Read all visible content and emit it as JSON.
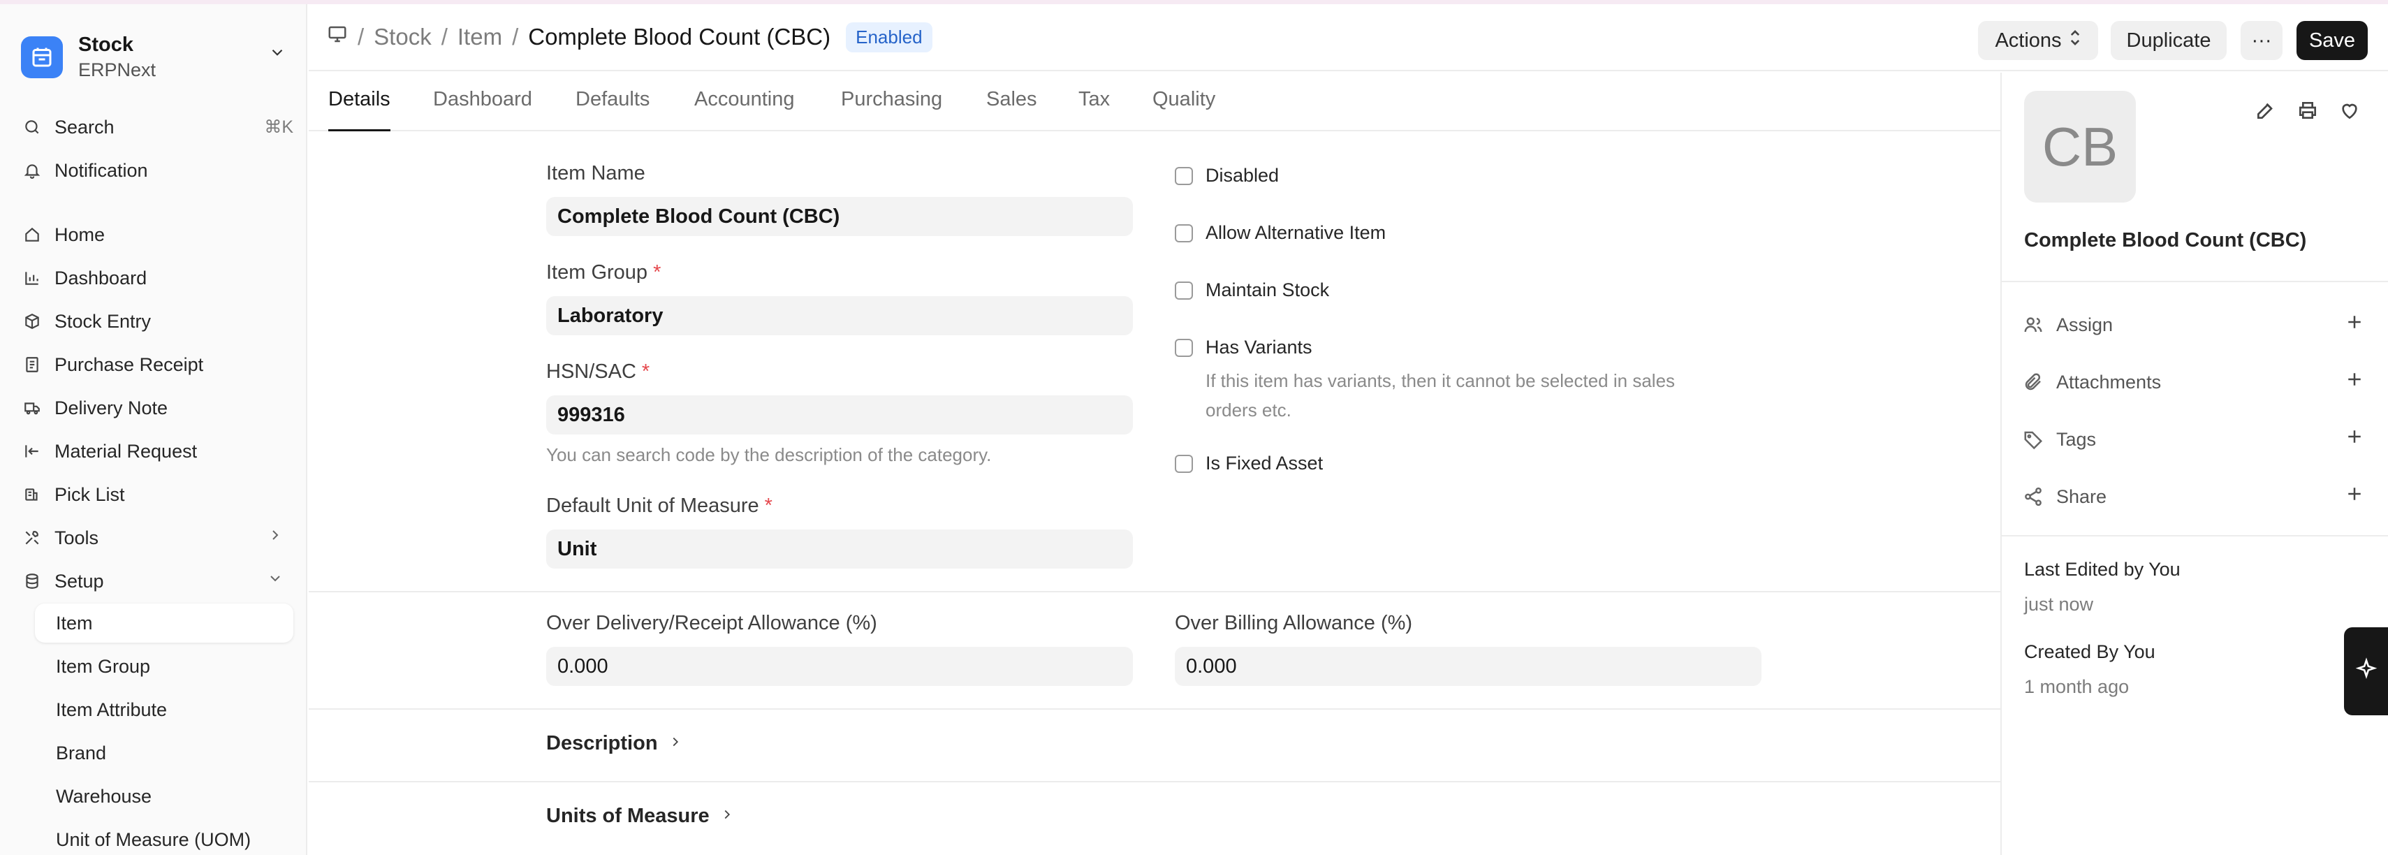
{
  "app": {
    "name": "Stock",
    "subtitle": "ERPNext"
  },
  "sidebar": {
    "search": {
      "label": "Search",
      "shortcut": "⌘K"
    },
    "notification": {
      "label": "Notification"
    },
    "items": [
      {
        "label": "Home",
        "icon": "home-icon"
      },
      {
        "label": "Dashboard",
        "icon": "bar-chart-icon"
      },
      {
        "label": "Stock Entry",
        "icon": "box-icon"
      },
      {
        "label": "Purchase Receipt",
        "icon": "receipt-icon"
      },
      {
        "label": "Delivery Note",
        "icon": "truck-icon"
      },
      {
        "label": "Material Request",
        "icon": "arrow-left-bar-icon"
      },
      {
        "label": "Pick List",
        "icon": "pick-list-icon"
      },
      {
        "label": "Tools",
        "icon": "tools-icon"
      },
      {
        "label": "Setup",
        "icon": "database-icon"
      }
    ],
    "setup_children": [
      {
        "label": "Item",
        "active": true
      },
      {
        "label": "Item Group"
      },
      {
        "label": "Item Attribute"
      },
      {
        "label": "Brand"
      },
      {
        "label": "Warehouse"
      },
      {
        "label": "Unit of Measure (UOM)"
      }
    ]
  },
  "breadcrumb": {
    "items": [
      "Stock",
      "Item"
    ],
    "current": "Complete Blood Count (CBC)",
    "status_badge": "Enabled"
  },
  "toolbar": {
    "actions_label": "Actions",
    "duplicate_label": "Duplicate",
    "more_label": "···",
    "save_label": "Save"
  },
  "tabs": [
    {
      "label": "Details",
      "active": true
    },
    {
      "label": "Dashboard"
    },
    {
      "label": "Defaults"
    },
    {
      "label": "Accounting"
    },
    {
      "label": "Purchasing"
    },
    {
      "label": "Sales"
    },
    {
      "label": "Tax"
    },
    {
      "label": "Quality"
    }
  ],
  "form": {
    "item_name": {
      "label": "Item Name",
      "value": "Complete Blood Count (CBC)"
    },
    "item_group": {
      "label": "Item Group",
      "required": "*",
      "value": "Laboratory"
    },
    "hsn_sac": {
      "label": "HSN/SAC",
      "required": "*",
      "value": "999316",
      "help": "You can search code by the description of the category."
    },
    "default_uom": {
      "label": "Default Unit of Measure",
      "required": "*",
      "value": "Unit"
    },
    "checkboxes": {
      "disabled": "Disabled",
      "allow_alternative": "Allow Alternative Item",
      "maintain_stock": "Maintain Stock",
      "has_variants": "Has Variants",
      "has_variants_help_1": "If this item has variants, then it cannot be selected in sales",
      "has_variants_help_2": "orders etc.",
      "is_fixed_asset": "Is Fixed Asset"
    },
    "over_delivery": {
      "label": "Over Delivery/Receipt Allowance (%)",
      "value": "0.000"
    },
    "over_billing": {
      "label": "Over Billing Allowance (%)",
      "value": "0.000"
    },
    "sections": {
      "description": "Description",
      "units_of_measure": "Units of Measure"
    }
  },
  "right_panel": {
    "avatar_initials": "CB",
    "title": "Complete Blood Count (CBC)",
    "rows": [
      {
        "label": "Assign",
        "icon": "users-icon"
      },
      {
        "label": "Attachments",
        "icon": "paperclip-icon"
      },
      {
        "label": "Tags",
        "icon": "tag-icon"
      },
      {
        "label": "Share",
        "icon": "share-icon"
      }
    ],
    "last_edited": "Last Edited by You",
    "last_edited_time": "just now",
    "created_by": "Created By You",
    "created_time": "1 month ago"
  },
  "colors": {
    "accent": "#3b82f6",
    "badge_bg": "#e7f1ff",
    "badge_text": "#2563c9",
    "primary_button": "#171717"
  }
}
